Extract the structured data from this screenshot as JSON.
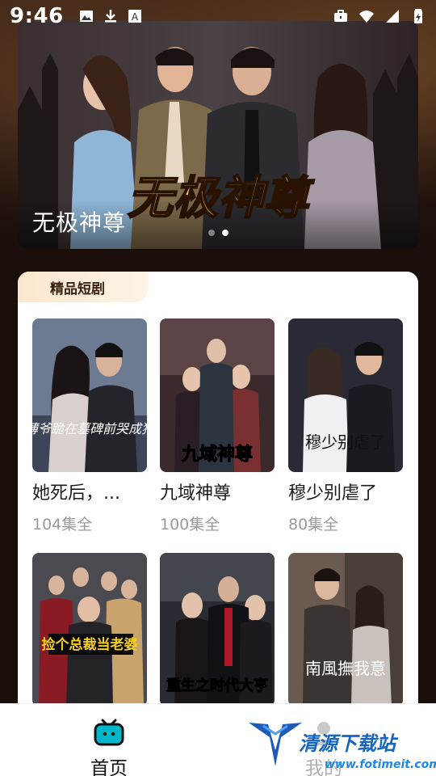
{
  "status_bar": {
    "time": "9:46",
    "left_icons": [
      "image-icon",
      "download-icon",
      "font-icon"
    ],
    "right_icons": [
      "briefcase-icon",
      "wifi-icon",
      "signal-icon",
      "battery-icon"
    ]
  },
  "banner": {
    "poster_title": "无极神尊",
    "caption": "无极神尊",
    "dots": 2,
    "active_dot": 1
  },
  "section": {
    "tab_label": "精品短剧"
  },
  "dramas": [
    {
      "title": "她死后，...",
      "count": "104集全",
      "poster_text": "薄爷跪在墓碑前哭成狗"
    },
    {
      "title": "九域神尊",
      "count": "100集全",
      "poster_text": "九域神尊"
    },
    {
      "title": "穆少别虐了",
      "count": "80集全",
      "poster_text": "穆少别虐了"
    },
    {
      "title": "",
      "count": "",
      "poster_text": "捡个总裁当老婆"
    },
    {
      "title": "",
      "count": "",
      "poster_text": "重生之时代大亨"
    },
    {
      "title": "",
      "count": "",
      "poster_text": "南風撫我意"
    }
  ],
  "bottom_nav": {
    "home_label": "首页",
    "mine_label": "我的"
  },
  "watermark": {
    "name": "清源下载站",
    "url": "www.fotimeit.com"
  },
  "colors": {
    "accent": "#00b7c9",
    "tab_bg": "#fbe7cf",
    "page_bg": "#1a0e0b"
  }
}
